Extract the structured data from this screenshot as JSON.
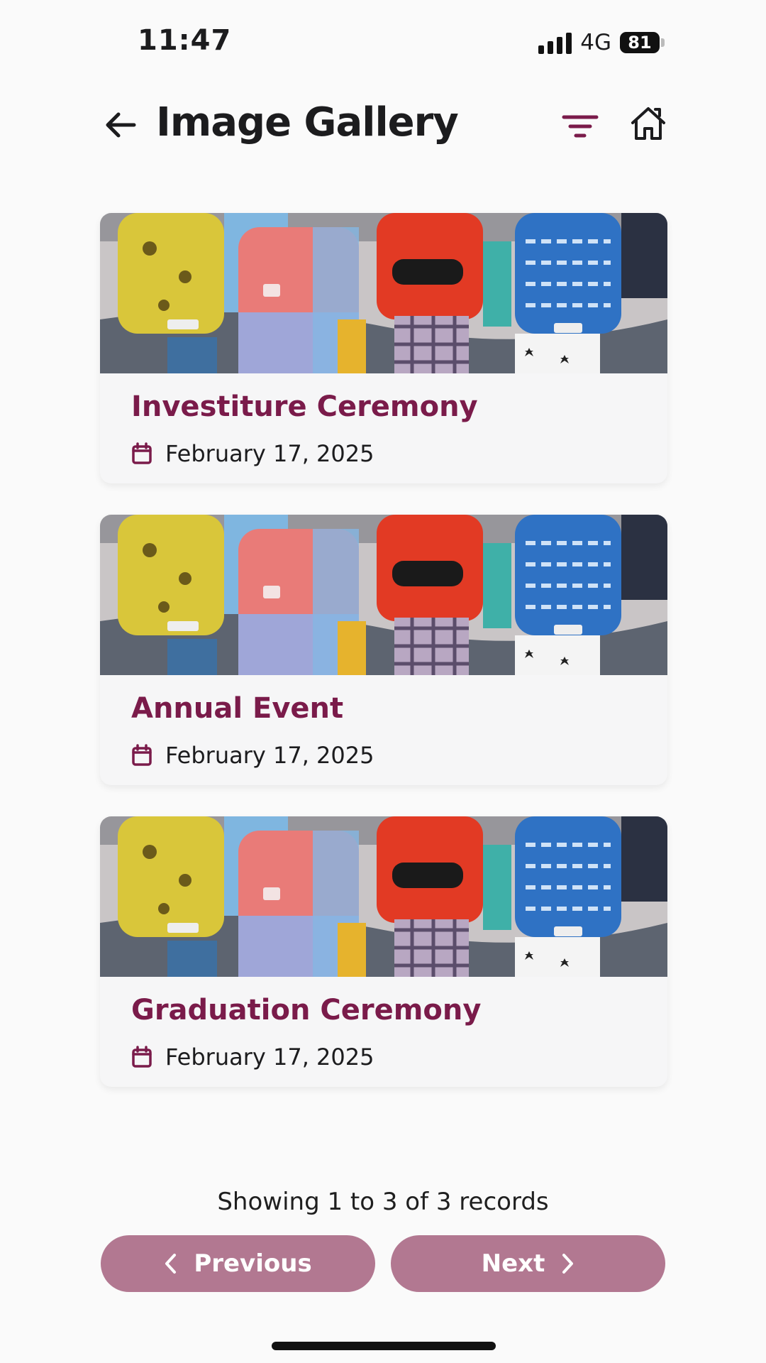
{
  "colors": {
    "accent": "#7a1b4a",
    "button": "#b27891",
    "background": "#fafafa"
  },
  "status_bar": {
    "time": "11:47",
    "network": "4G",
    "battery": "81"
  },
  "header": {
    "title": "Image Gallery",
    "back_icon": "arrow-left-icon",
    "filter_icon": "filter-icon",
    "home_icon": "home-icon"
  },
  "gallery": {
    "items": [
      {
        "title": "Investiture Ceremony",
        "date": "February 17, 2025"
      },
      {
        "title": "Annual Event",
        "date": "February 17, 2025"
      },
      {
        "title": "Graduation Ceremony",
        "date": "February 17, 2025"
      }
    ]
  },
  "pagination": {
    "summary": "Showing 1 to 3 of 3 records",
    "previous_label": "Previous",
    "next_label": "Next"
  }
}
